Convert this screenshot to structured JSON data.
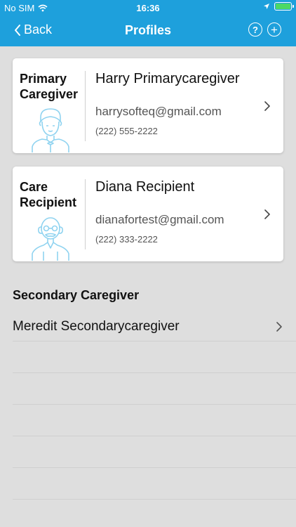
{
  "status_bar": {
    "carrier": "No SIM",
    "time": "16:36"
  },
  "nav": {
    "back_label": "Back",
    "title": "Profiles",
    "help_label": "?",
    "add_label": "+"
  },
  "profiles": [
    {
      "role_line1": "Primary",
      "role_line2": "Caregiver",
      "name": "Harry Primarycaregiver",
      "email": "harrysofteq@gmail.com",
      "phone": "(222) 555-2222"
    },
    {
      "role_line1": "Care",
      "role_line2": "Recipient",
      "name": "Diana Recipient",
      "email": "dianafortest@gmail.com",
      "phone": "(222) 333-2222"
    }
  ],
  "secondary": {
    "section_title": "Secondary Caregiver",
    "items": [
      {
        "name": "Meredit Secondarycaregiver"
      }
    ]
  },
  "colors": {
    "header_bg": "#1ea0dc",
    "page_bg": "#dedede",
    "avatar_stroke": "#8fd3f0",
    "battery": "#4cd964"
  }
}
